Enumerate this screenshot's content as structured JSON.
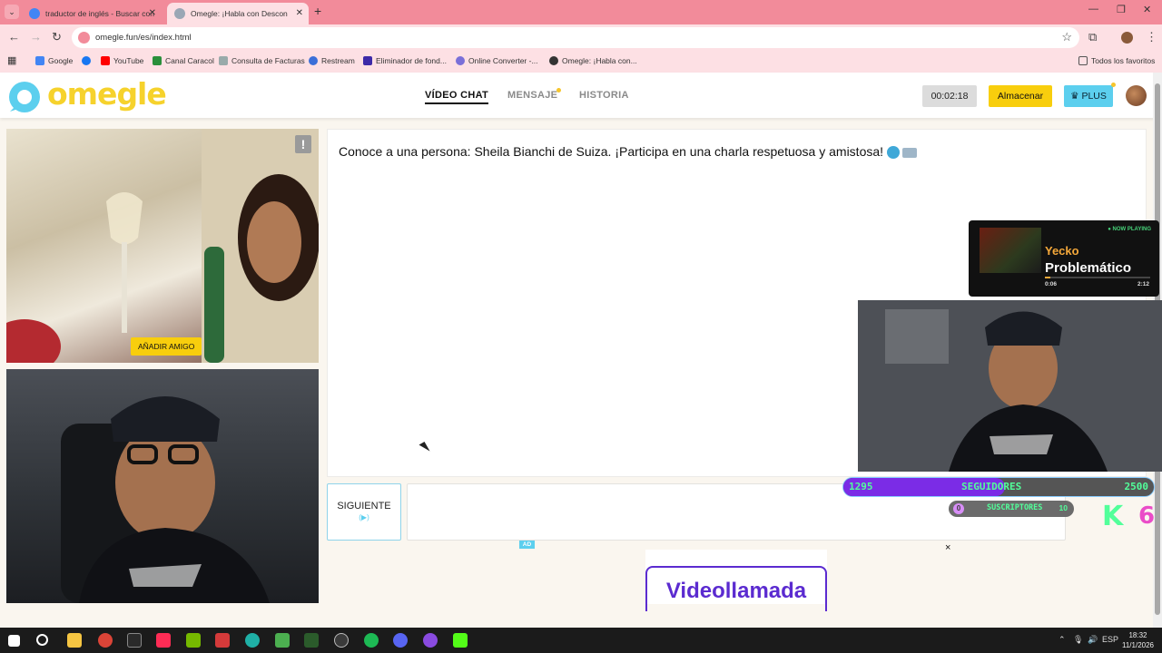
{
  "browser": {
    "tabs": [
      {
        "title": "traductor de inglés - Buscar con"
      },
      {
        "title": "Omegle: ¡Habla con Descon"
      }
    ],
    "url": "omegle.fun/es/index.html",
    "bookmarks": [
      {
        "label": "Google"
      },
      {
        "label": "YouTube"
      },
      {
        "label": "Canal Caracol"
      },
      {
        "label": "Consulta de Facturas"
      },
      {
        "label": "Restream"
      },
      {
        "label": "Eliminador de fond..."
      },
      {
        "label": "Online Converter -..."
      },
      {
        "label": "Omegle: ¡Habla con..."
      }
    ],
    "all_bookmarks": "Todos los favoritos"
  },
  "site": {
    "logo": "omegle",
    "nav": [
      {
        "label": "VÍDEO CHAT"
      },
      {
        "label": "MENSAJE"
      },
      {
        "label": "HISTORIA"
      }
    ],
    "timer": "00:02:18",
    "store_button": "Almacenar",
    "plus_button": "PLUS",
    "plus_icon": "crown-icon"
  },
  "video": {
    "report": "!",
    "add_friend": "AÑADIR AMIGO"
  },
  "chat": {
    "message": "Conoce a una persona: Sheila Bianchi de Suiza. ¡Participa en una charla respetuosa y amistosa!",
    "next_button": "SIGUIENTE",
    "input_value": ""
  },
  "ad": {
    "badge": "AD",
    "button": "Videollamada",
    "close": "×"
  },
  "overlay": {
    "now_playing_tag": "● NOW PLAYING",
    "artist": "Yecko",
    "song": "Problemático",
    "elapsed": "0:06",
    "duration": "2:12",
    "progress": 0.05,
    "goal_current": "1295",
    "goal_label": "SEGUIDORES",
    "goal_max": "2500",
    "goal_progress": 0.52,
    "sub_current": "0",
    "sub_label": "SUSCRIPTORES",
    "sub_max": "10",
    "k_letter": "K",
    "k_number": "6"
  },
  "taskbar": {
    "lang": "ESP",
    "time": "18:32",
    "date": "11/1/2026"
  },
  "colors": {
    "accent_yellow": "#f8ce0d",
    "plus_blue": "#5ccfee",
    "tab_pink": "#f28b9a"
  }
}
